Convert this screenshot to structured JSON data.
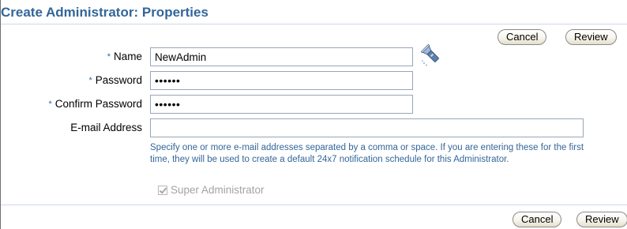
{
  "page": {
    "title": "Create Administrator: Properties"
  },
  "top_actions": {
    "cancel_label": "Cancel",
    "review_label": "Review"
  },
  "form": {
    "required_marker": "*",
    "name": {
      "label": "Name",
      "value": "NewAdmin",
      "required": true
    },
    "search_icon": "flashlight-icon",
    "password": {
      "label": "Password",
      "value": "••••••",
      "required": true
    },
    "confirm_password": {
      "label": "Confirm Password",
      "value": "••••••",
      "required": true
    },
    "email": {
      "label": "E-mail Address",
      "value": "",
      "hint": "Specify one or more e-mail addresses separated by a comma or space. If you are entering these for the first time, they will be used to create a default 24x7 notification schedule for this Administrator."
    },
    "super_admin": {
      "label": "Super Administrator",
      "checked": true,
      "disabled": true
    }
  },
  "bottom_actions": {
    "cancel_label": "Cancel",
    "review_label": "Review"
  },
  "colors": {
    "title": "#336699",
    "hint_text": "#336699",
    "disabled_text": "#a3a3a3",
    "field_border": "#98a6b8",
    "rule": "#cfd9e6"
  }
}
